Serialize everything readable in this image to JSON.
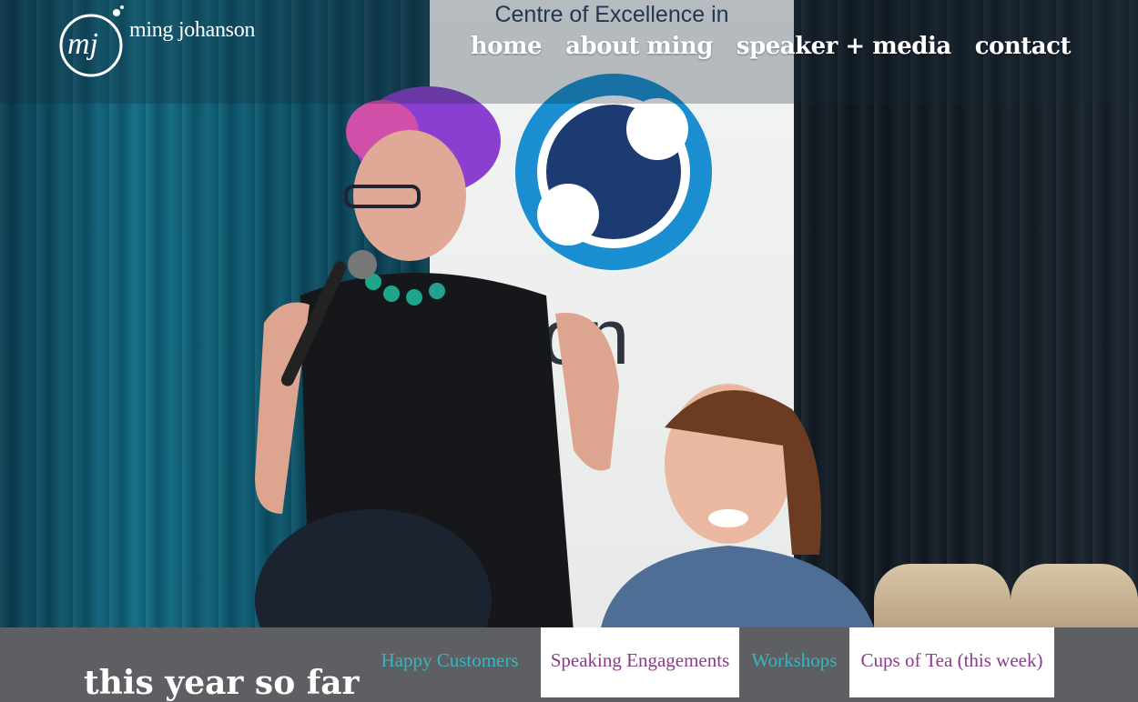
{
  "logo": {
    "name": "ming johanson",
    "mark_text": "mj"
  },
  "nav": {
    "items": [
      {
        "label": "home"
      },
      {
        "label": "about ming"
      },
      {
        "label": "speaker + media"
      },
      {
        "label": "contact"
      }
    ]
  },
  "hero": {
    "banner_heading": "Centre of Excellence in",
    "banner_partial_text": "riton"
  },
  "stats": {
    "heading": "this year so far",
    "tabs": [
      {
        "label": "Happy Customers",
        "color": "#3ab5c0"
      },
      {
        "label": "Speaking Engagements",
        "color": "#8a3b8c"
      },
      {
        "label": "Workshops",
        "color": "#3ab5c0"
      },
      {
        "label": "Cups of Tea (this week)",
        "color": "#8a3b8c"
      }
    ]
  },
  "colors": {
    "accent_teal": "#3ab5c0",
    "accent_purple": "#8a3b8c",
    "stats_bg": "#5e5f62"
  }
}
